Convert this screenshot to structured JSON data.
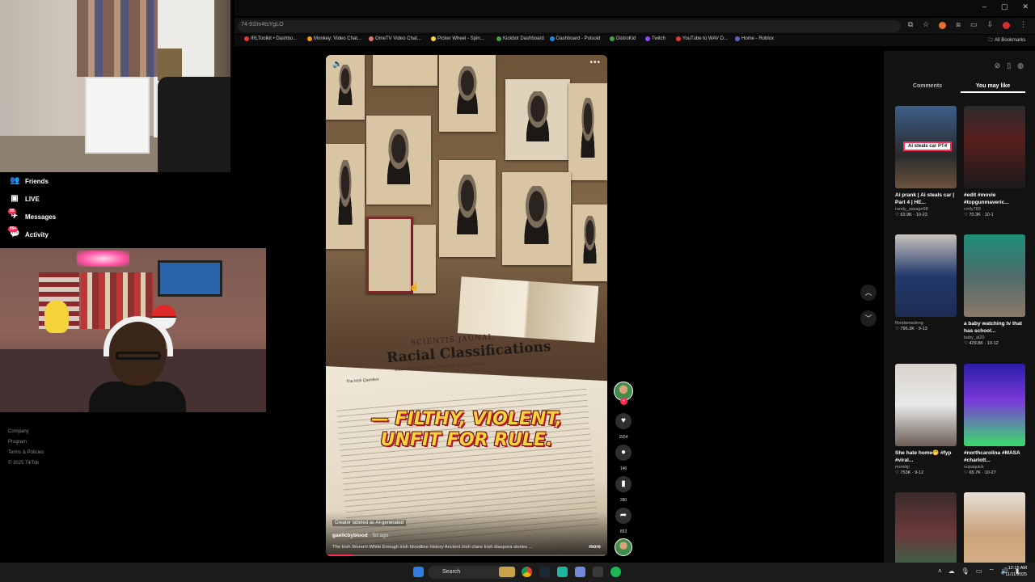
{
  "browser": {
    "url": "74-91lm4tsYgLO",
    "window_controls": [
      "–",
      "▢",
      "✕"
    ],
    "bookmarks": [
      {
        "label": "IRLToolkit • Dashbo...",
        "color": "#e53935"
      },
      {
        "label": "Monkey: Video Chat...",
        "color": "#ff9800"
      },
      {
        "label": "OmeTV Video Chat...",
        "color": "#e57373"
      },
      {
        "label": "Picker Wheel - Spin...",
        "color": "#fdd835"
      },
      {
        "label": "Kickbot Dashboard",
        "color": "#43a047"
      },
      {
        "label": "Dashboard - Pulsoid",
        "color": "#1e88e5"
      },
      {
        "label": "DistroKid",
        "color": "#43a047"
      },
      {
        "label": "Twitch",
        "color": "#9146ff"
      },
      {
        "label": "YouTube to WAV D...",
        "color": "#e53935"
      },
      {
        "label": "Home - Roblox",
        "color": "#5c6bc0"
      }
    ],
    "all_bookmarks_label": "All Bookmarks"
  },
  "sidebar": {
    "items": [
      {
        "label": "Friends",
        "icon": "friends-icon",
        "glyph": "👥",
        "badge": ""
      },
      {
        "label": "LIVE",
        "icon": "live-icon",
        "glyph": "▣",
        "badge": ""
      },
      {
        "label": "Messages",
        "icon": "messages-icon",
        "glyph": "✈",
        "badge": "99"
      },
      {
        "label": "Activity",
        "icon": "activity-icon",
        "glyph": "💬",
        "badge": "99+"
      }
    ],
    "footer": [
      "Company",
      "Program",
      "Terms & Policies",
      "© 2025 TikTok"
    ]
  },
  "video": {
    "newspaper_masthead": "SCIENTIS JAUNAL",
    "newspaper_headline": "Racial Classifications",
    "newspaper_subhead": "Ethnological Studies Towards the Irish Race",
    "newspaper_byline": "The Irish Question",
    "caption_line1": "— FILTHY, VIOLENT,",
    "caption_line2": "UNFIT FOR RULE.",
    "ai_label": "Creator labeled as AI-generated",
    "author": "gaelicbyblood",
    "posted": "· 5d ago",
    "description": "The Irish Weren't White Enough  irish bloodline history Ancient Irish clans Irish diaspora stories ...",
    "more_label": "more",
    "progress": 0.1
  },
  "actions": {
    "likes": "1554",
    "comments": "146",
    "saves": "280",
    "shares": "853"
  },
  "right_panel": {
    "tabs": [
      "Comments",
      "You may like"
    ],
    "active_tab": "You may like",
    "cards": [
      {
        "title": "Ai prank | Ai steals car | Part 4 | HE...",
        "author": "randy_savage98",
        "stats": "♡ 63.9K · 10-23",
        "overlay": "Ai steals car PT4",
        "bg": "linear-gradient(180deg,#3b5f8a,#2a2a2a 60%,#6b5440)"
      },
      {
        "title": "#edit #movie #topgunmaveric...",
        "author": "cmfy789",
        "stats": "♡ 70.3K · 10-1",
        "overlay": "",
        "bg": "linear-gradient(180deg,#2b2b2b,#5a1f1f 40%,#1a1a1a)"
      },
      {
        "title": "",
        "author": "floridamadeng",
        "stats": "♡ 796.3K · 9-13",
        "overlay": "",
        "bg": "linear-gradient(180deg,#c9c4bd,#233a6b 50%,#1d2b52)"
      },
      {
        "title": "a baby watching tv that has school...",
        "author": "baby_ai20",
        "stats": "♡ 429.8K · 10-12",
        "overlay": "",
        "bg": "linear-gradient(180deg,#1f8f7a,#4d6b6a 50%,#8c7a68)"
      },
      {
        "title": "She hate home🤭 #fyp #viral...",
        "author": "morekji",
        "stats": "♡ 753K · 9-12",
        "overlay": "",
        "bg": "linear-gradient(180deg,#d8d3cb,#e9e9e9 50%,#6b5e55)"
      },
      {
        "title": "#northcarolina #MASA #charlott...",
        "author": "supaquick",
        "stats": "♡ 65.7K · 10-27",
        "overlay": "",
        "bg": "linear-gradient(180deg,#2a1ea8,#7a3bd9 45%,#3bdc6b)"
      },
      {
        "title": "",
        "author": "",
        "stats": "",
        "overlay": "",
        "bg": "linear-gradient(180deg,#3a2a2a,#6b3a3a 50%,#2d6b4a)"
      },
      {
        "title": "",
        "author": "",
        "stats": "",
        "overlay": "",
        "bg": "linear-gradient(180deg,#e6e0d6,#c9a27a 50%,#d9b48a)"
      }
    ]
  },
  "taskbar": {
    "search_placeholder": "Search",
    "time": "12:15 AM",
    "date": "11/11/2025"
  },
  "colors": {
    "accent": "#fe2c55",
    "caption_yellow": "#f4d33d"
  }
}
